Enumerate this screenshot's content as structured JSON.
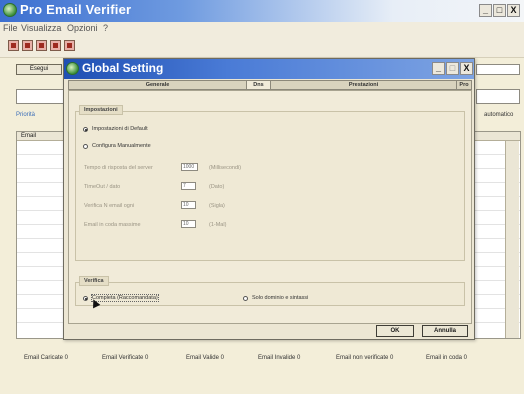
{
  "main_window": {
    "title": "Pro Email Verifier",
    "controls": {
      "minimize": "_",
      "maximize": "□",
      "close": "X"
    }
  },
  "menu": [
    "File",
    "Visualizza",
    "Opzioni",
    "?"
  ],
  "toolbar": {
    "icons": [
      "toolbar-icon-1",
      "toolbar-icon-2",
      "toolbar-icon-3",
      "toolbar-icon-4",
      "toolbar-icon-5"
    ],
    "execute_label": "Esegui"
  },
  "main_body": {
    "left_label_1": "Priorità",
    "right_label": "automatico",
    "grid_header": "Email"
  },
  "status_bar": [
    "Email Caricate  0",
    "Email Verificate  0",
    "Email Valide  0",
    "Email Invalide  0",
    "Email non verificate  0",
    "Email in coda  0"
  ],
  "dialog": {
    "title": "Global Setting",
    "controls": {
      "minimize": "_",
      "maximize": "□",
      "close": "X"
    },
    "tabs": [
      "Generale",
      "Dns",
      "Prestazioni",
      "Pro"
    ],
    "settings_group": {
      "title": "Impostazioni",
      "option_default": "Impostazioni di Default",
      "option_manual": "Configura Manualmente",
      "fields": [
        {
          "label": "Tempo di risposta del server",
          "value": "1000",
          "unit": "(Millisecondi)"
        },
        {
          "label": "TimeOut / dato",
          "value": "7",
          "unit": "(Dato)"
        },
        {
          "label": "Verifica N email ogni",
          "value": "10",
          "unit": "(Sigla)"
        },
        {
          "label": "Email in coda massime",
          "value": "10",
          "unit": "(1-Mal)"
        }
      ]
    },
    "verify_group": {
      "title": "Verifica",
      "option_complete": "Completa (Raccomandata)",
      "option_domain": "Solo dominio e sintassi"
    },
    "buttons": {
      "ok": "OK",
      "cancel": "Annulla"
    }
  }
}
